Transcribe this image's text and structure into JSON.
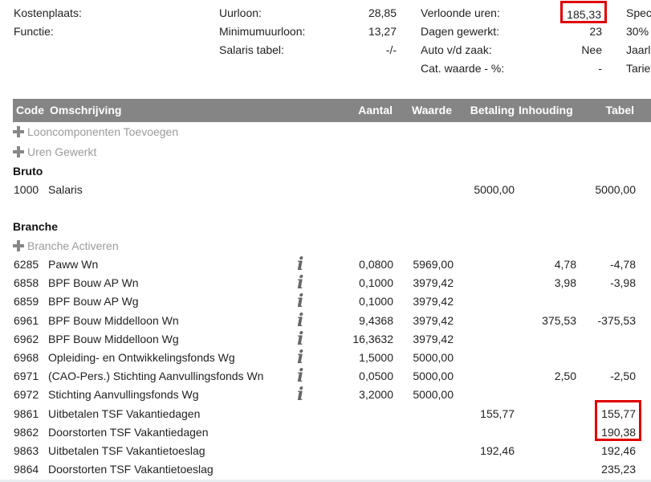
{
  "info": {
    "kostenplaats_label": "Kostenplaats:",
    "functie_label": "Functie:",
    "uurloon_label": "Uurloon:",
    "uurloon_value": "28,85",
    "minimumuurloon_label": "Minimumuurloon:",
    "minimumuurloon_value": "13,27",
    "salaris_tabel_label": "Salaris tabel:",
    "salaris_tabel_value": "-/-",
    "verloonde_uren_label": "Verloonde uren:",
    "verloonde_uren_value": "185,33",
    "dagen_gewerkt_label": "Dagen gewerkt:",
    "dagen_gewerkt_value": "23",
    "auto_label": "Auto v/d zaak:",
    "auto_value": "Nee",
    "cat_waarde_label": "Cat. waarde - %:",
    "cat_waarde_value": "-",
    "col4_row1": "Spec",
    "col4_row2": "30%",
    "col4_row3": "Jaarl",
    "col4_row4": "Tarief"
  },
  "table": {
    "headers": {
      "code": "Code",
      "omschrijving": "Omschrijving",
      "aantal": "Aantal",
      "waarde": "Waarde",
      "betaling": "Betaling",
      "inhouding": "Inhouding",
      "tabel": "Tabel"
    },
    "actions": {
      "looncomponenten": "Looncomponenten Toevoegen",
      "uren": "Uren Gewerkt",
      "branche": "Branche Activeren"
    },
    "sections": {
      "bruto": "Bruto",
      "branche": "Branche"
    },
    "bruto_rows": [
      {
        "code": "1000",
        "desc": "Salaris",
        "aantal": "",
        "waarde": "",
        "betaling": "5000,00",
        "inhouding": "",
        "tabel": "5000,00"
      }
    ],
    "branche_rows": [
      {
        "code": "6285",
        "desc": "Paww Wn",
        "info": "i",
        "aantal": "0,0800",
        "waarde": "5969,00",
        "betaling": "",
        "inhouding": "4,78",
        "tabel": "-4,78"
      },
      {
        "code": "6858",
        "desc": "BPF Bouw AP Wn",
        "info": "i",
        "aantal": "0,1000",
        "waarde": "3979,42",
        "betaling": "",
        "inhouding": "3,98",
        "tabel": "-3,98"
      },
      {
        "code": "6859",
        "desc": "BPF Bouw AP Wg",
        "info": "i",
        "aantal": "0,1000",
        "waarde": "3979,42",
        "betaling": "",
        "inhouding": "",
        "tabel": ""
      },
      {
        "code": "6961",
        "desc": "BPF Bouw Middelloon Wn",
        "info": "i",
        "aantal": "9,4368",
        "waarde": "3979,42",
        "betaling": "",
        "inhouding": "375,53",
        "tabel": "-375,53"
      },
      {
        "code": "6962",
        "desc": "BPF Bouw Middelloon Wg",
        "info": "i",
        "aantal": "16,3632",
        "waarde": "3979,42",
        "betaling": "",
        "inhouding": "",
        "tabel": ""
      },
      {
        "code": "6968",
        "desc": "Opleiding- en Ontwikkelingsfonds Wg",
        "info": "i",
        "aantal": "1,5000",
        "waarde": "5000,00",
        "betaling": "",
        "inhouding": "",
        "tabel": ""
      },
      {
        "code": "6971",
        "desc": "(CAO-Pers.) Stichting Aanvullingsfonds Wn",
        "info": "i",
        "aantal": "0,0500",
        "waarde": "5000,00",
        "betaling": "",
        "inhouding": "2,50",
        "tabel": "-2,50"
      },
      {
        "code": "6972",
        "desc": "Stichting Aanvullingsfonds Wg",
        "info": "i",
        "aantal": "3,2000",
        "waarde": "5000,00",
        "betaling": "",
        "inhouding": "",
        "tabel": ""
      },
      {
        "code": "9861",
        "desc": "Uitbetalen TSF Vakantiedagen",
        "info": "",
        "aantal": "",
        "waarde": "",
        "betaling": "155,77",
        "inhouding": "",
        "tabel": "155,77"
      },
      {
        "code": "9862",
        "desc": "Doorstorten TSF Vakantiedagen",
        "info": "",
        "aantal": "",
        "waarde": "",
        "betaling": "",
        "inhouding": "",
        "tabel": "190,38"
      },
      {
        "code": "9863",
        "desc": "Uitbetalen TSF Vakantietoeslag",
        "info": "",
        "aantal": "",
        "waarde": "",
        "betaling": "192,46",
        "inhouding": "",
        "tabel": "192,46"
      },
      {
        "code": "9864",
        "desc": "Doorstorten TSF Vakantietoeslag",
        "info": "",
        "aantal": "",
        "waarde": "",
        "betaling": "",
        "inhouding": "",
        "tabel": "235,23"
      }
    ]
  },
  "colors": {
    "header_bg": "#858585",
    "highlight": "#e00000",
    "action_text": "#9a9a9a"
  }
}
